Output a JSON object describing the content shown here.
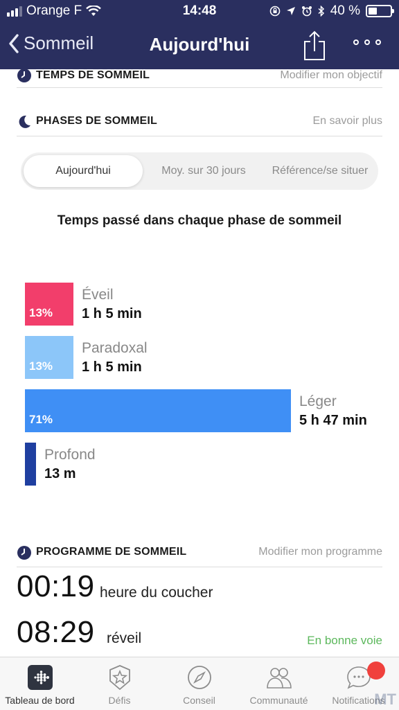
{
  "status_bar": {
    "carrier": "Orange F",
    "time": "14:48",
    "battery_text": "40 %",
    "battery_level": 0.4
  },
  "nav": {
    "back_label": "Sommeil",
    "title": "Aujourd'hui",
    "back_icon": "chevron-left-icon",
    "share_icon": "share-icon",
    "more_icon": "more-dots-icon"
  },
  "sections": {
    "sleep_time": {
      "label": "TEMPS DE SOMMEIL",
      "link": "Modifier mon objectif"
    },
    "phases": {
      "label": "PHASES DE SOMMEIL",
      "link": "En savoir plus"
    },
    "program": {
      "label": "PROGRAMME DE SOMMEIL",
      "link": "Modifier mon programme"
    }
  },
  "segments": [
    "Aujourd'hui",
    "Moy. sur 30 jours",
    "Référence/se situer"
  ],
  "selected_segment": "Aujourd'hui",
  "chart_title": "Temps passé dans chaque phase de sommeil",
  "chart_data": {
    "type": "bar",
    "categories": [
      "Éveil",
      "Paradoxal",
      "Léger",
      "Profond"
    ],
    "series": [
      {
        "values": [
          13,
          13,
          71,
          3
        ]
      }
    ],
    "value_labels": [
      "13%",
      "13%",
      "71%",
      ""
    ],
    "durations": [
      "1 h 5 min",
      "1 h 5 min",
      "5 h 47 min",
      "13 m"
    ],
    "colors": [
      "#f23e6b",
      "#8cc6f9",
      "#3f8ff5",
      "#1f3fa0"
    ]
  },
  "program": {
    "bedtime": "00:19",
    "bedtime_label": "heure du coucher",
    "wake": "08:29",
    "wake_label": "réveil",
    "status": "En bonne voie"
  },
  "tabs": [
    {
      "label": "Tableau de bord",
      "icon": "dashboard-icon"
    },
    {
      "label": "Défis",
      "icon": "star-badge-icon"
    },
    {
      "label": "Conseil",
      "icon": "compass-icon"
    },
    {
      "label": "Communauté",
      "icon": "people-icon"
    },
    {
      "label": "Notifications",
      "icon": "chat-bubble-icon"
    }
  ],
  "accent": "#2a2f5f"
}
